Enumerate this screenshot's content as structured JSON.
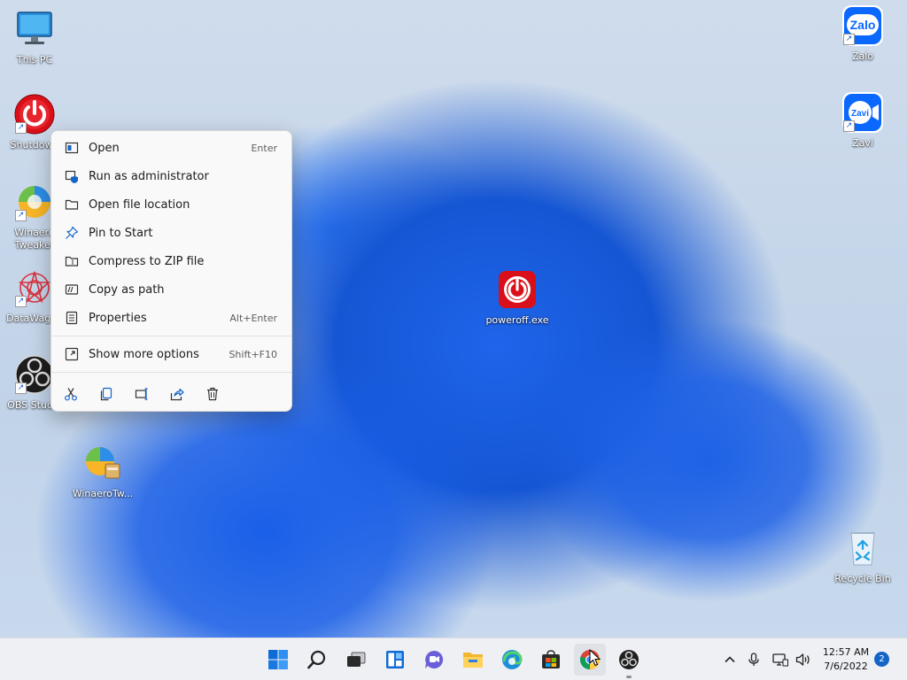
{
  "desktop": {
    "icons": [
      {
        "label": "This PC",
        "icon": "monitor-icon"
      },
      {
        "label": "Shutdown",
        "icon": "power-icon"
      },
      {
        "label": "Winaero Tweaker",
        "icon": "winaero-tweaker-icon"
      },
      {
        "label": "DataWagon",
        "icon": "datawagon-icon"
      },
      {
        "label": "OBS Studio",
        "icon": "obs-icon"
      },
      {
        "label": "WinaeroTw...",
        "icon": "winaero-installer-icon"
      },
      {
        "label": "poweroff.exe",
        "icon": "power-icon"
      },
      {
        "label": "Zalo",
        "icon": "zalo-icon",
        "badge_text": "Zalo"
      },
      {
        "label": "Zavi",
        "icon": "zavi-icon",
        "badge_text": "Zavi"
      },
      {
        "label": "Recycle Bin",
        "icon": "recycle-bin-icon"
      }
    ]
  },
  "context_menu": {
    "items": [
      {
        "label": "Open",
        "shortcut": "Enter",
        "icon": "open-icon"
      },
      {
        "label": "Run as administrator",
        "shortcut": "",
        "icon": "shield-icon"
      },
      {
        "label": "Open file location",
        "shortcut": "",
        "icon": "folder-icon"
      },
      {
        "label": "Pin to Start",
        "shortcut": "",
        "icon": "pin-icon"
      },
      {
        "label": "Compress to ZIP file",
        "shortcut": "",
        "icon": "zip-icon"
      },
      {
        "label": "Copy as path",
        "shortcut": "",
        "icon": "copy-path-icon"
      },
      {
        "label": "Properties",
        "shortcut": "Alt+Enter",
        "icon": "properties-icon"
      }
    ],
    "more": {
      "label": "Show more options",
      "shortcut": "Shift+F10",
      "icon": "show-more-icon"
    },
    "quick_actions": [
      "cut-icon",
      "copy-icon",
      "rename-icon",
      "share-icon",
      "delete-icon"
    ]
  },
  "taskbar": {
    "apps": [
      "start-icon",
      "search-icon",
      "task-view-icon",
      "widgets-icon",
      "chat-icon",
      "file-explorer-icon",
      "edge-icon",
      "store-icon",
      "chrome-icon",
      "obs-icon"
    ],
    "tray": [
      "chevron-up-icon",
      "microphone-icon",
      "network-icon",
      "speaker-icon"
    ],
    "time": "12:57 AM",
    "date": "7/6/2022",
    "notification_count": "2"
  },
  "colors": {
    "accent": "#1464c8",
    "wallpaper_blue": "#1f64ea",
    "power_red": "#d9101a"
  }
}
